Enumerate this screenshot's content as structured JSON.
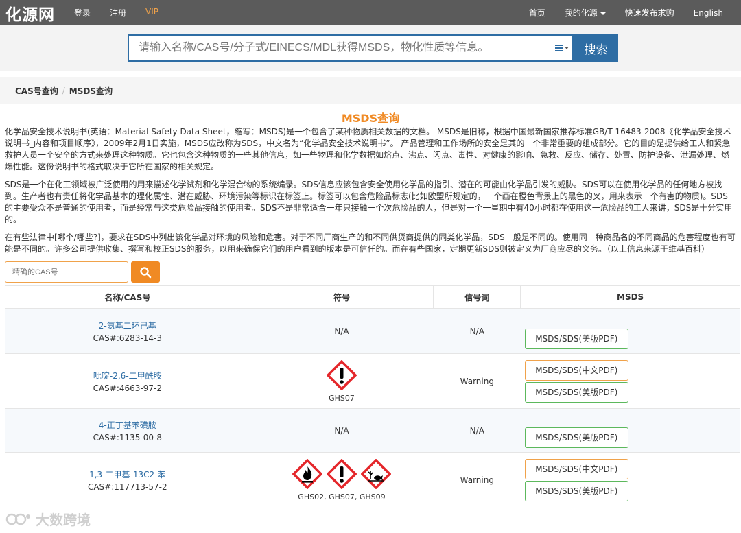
{
  "topbar": {
    "logo": "化源网",
    "login": "登录",
    "register": "注册",
    "vip": "VIP",
    "home": "首页",
    "my": "我的化源",
    "purchase": "快速发布求购",
    "lang": "English"
  },
  "search": {
    "placeholder": "请输入名称/CAS号/分子式/EINECS/MDL获得MSDS，物化性质等信息。",
    "button": "搜索"
  },
  "breadcrumb": {
    "item1": "CAS号查询",
    "sep": "/",
    "item2": "MSDS查询"
  },
  "page_title": "MSDS查询",
  "intro": {
    "p1": "化学品安全技术说明书(英语：Material Safety Data Sheet，缩写：MSDS)是一个包含了某种物质相关数据的文档。 MSDS是旧称，根据中国最新国家推荐标准GB/T 16483-2008《化学品安全技术说明书_内容和项目顺序》，2009年2月1日实施，MSDS应改称为SDS，中文名为“化学品安全技术说明书”。 产品管理和工作场所的安全是其的一个非常重要的组成部分。它的目的是提供给工人和紧急救护人员一个安全的方式来处理这种物质。它也包含这种物质的一些其他信息，如一些物理和化学数据如熔点、沸点、闪点、毒性、对健康的影响、急救、反应、储存、处置、防护设备、泄漏处理、燃爆性能。这份说明书的格式取决于它所在国家的相关规定。",
    "p2": "SDS是一个在化工领域被广泛使用的用来描述化学试剂和化学混合物的系统编录。SDS信息应该包含安全使用化学品的指引、潜在的可能由化学品引发的威胁。SDS可以在使用化学品的任何地方被找到。生产者也有责任将化学品基本的理化属性、潜在威胁、环境污染等标识在标签上。标签可以包含危险品标志(比如欧盟所规定的，一个画在橙色背景上的黑色的叉，用来表示一个有害的物质)。SDS的主要受众不是普通的使用者，而是经常与这类危险品接触的使用者。SDS不是非常适合一年只接触一个次危险品的人，但是对一个一星期中有40小时都在使用这一危险品的工人来讲，SDS是十分实用的。",
    "p3": "在有些法律中[哪个/哪些?]，要求在SDS中列出该化学品对环境的风险和危害。对于不同厂商生产的和不同供货商提供的同类化学品，SDS一般是不同的。使用同一种商品名的不同商品的危害程度也有可能是不同的。许多公司提供收集、撰写和校正SDS的服务，以用来确保它们的用户看到的版本是可信任的。而在有些国家，定期更新SDS则被定义为厂商应尽的义务。（以上信息来源于维基百科）"
  },
  "cas_search": {
    "placeholder": "精确的CAS号"
  },
  "table": {
    "headers": {
      "name": "名称/CAS号",
      "symbol": "符号",
      "signal": "信号词",
      "msds": "MSDS"
    },
    "rows": [
      {
        "name": "2-氨基二环己基",
        "cas": "CAS#:6283-14-3",
        "symbol_text": "N/A",
        "ghs_label": "",
        "signal": "N/A",
        "btn_en": "MSDS/SDS(美版PDF)",
        "btn_cn": ""
      },
      {
        "name": "吡啶-2,6-二甲酰胺",
        "cas": "CAS#:4663-97-2",
        "symbol_text": "",
        "ghs_label": "GHS07",
        "signal": "Warning",
        "btn_en": "MSDS/SDS(美版PDF)",
        "btn_cn": "MSDS/SDS(中文PDF)"
      },
      {
        "name": "4-正丁基苯磺胺",
        "cas": "CAS#:1135-00-8",
        "symbol_text": "N/A",
        "ghs_label": "",
        "signal": "N/A",
        "btn_en": "MSDS/SDS(美版PDF)",
        "btn_cn": ""
      },
      {
        "name": "1,3-二甲基-13C2-苯",
        "cas": "CAS#:117713-57-2",
        "symbol_text": "",
        "ghs_label": "GHS02, GHS07, GHS09",
        "signal": "Warning",
        "btn_en": "MSDS/SDS(美版PDF)",
        "btn_cn": "MSDS/SDS(中文PDF)"
      }
    ]
  },
  "watermark": "大数跨境",
  "colors": {
    "topbar": "#5b5b5b",
    "brand_blue": "#2e6da4",
    "accent_orange": "#f08a24",
    "ghs_red": "#e4262a",
    "btn_green": "#5cb85c"
  }
}
